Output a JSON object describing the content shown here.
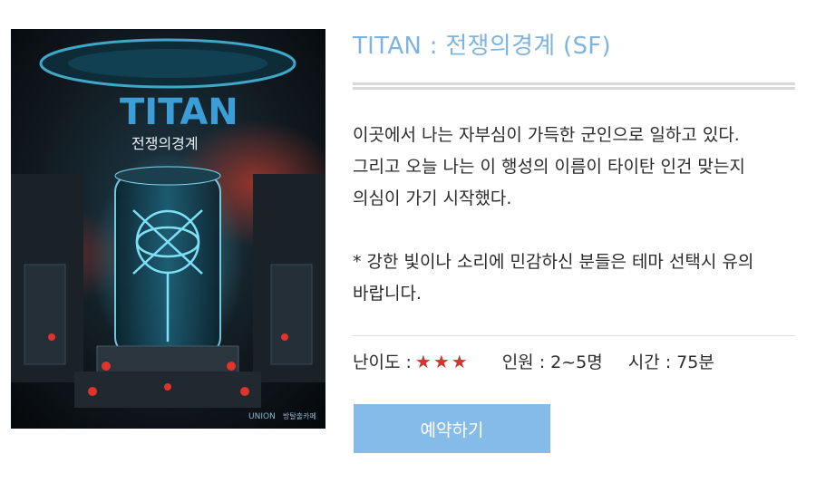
{
  "poster": {
    "title_text": "TITAN",
    "subtitle_text": "전쟁의경계",
    "logo_left": "UNION",
    "logo_right": "방탈출카페"
  },
  "theme": {
    "title": "TITAN : 전쟁의경계 (SF)",
    "description_lines": [
      "이곳에서 나는 자부심이 가득한 군인으로 일하고 있다.",
      "그리고 오늘 나는 이 행성의 이름이 타이탄 인건 맞는지",
      "의심이 가기 시작했다."
    ],
    "notice_lines": [
      "* 강한 빛이나 소리에 민감하신 분들은 테마 선택시 유의",
      "바랍니다."
    ]
  },
  "meta": {
    "difficulty_label": "난이도 :",
    "difficulty_stars": 3,
    "people": "인원 : 2~5명",
    "time": "시간 : 75분"
  },
  "reserve_button": "예약하기",
  "colors": {
    "title": "#7fb3e0",
    "button": "#85bbe9",
    "star": "#d6322e"
  }
}
